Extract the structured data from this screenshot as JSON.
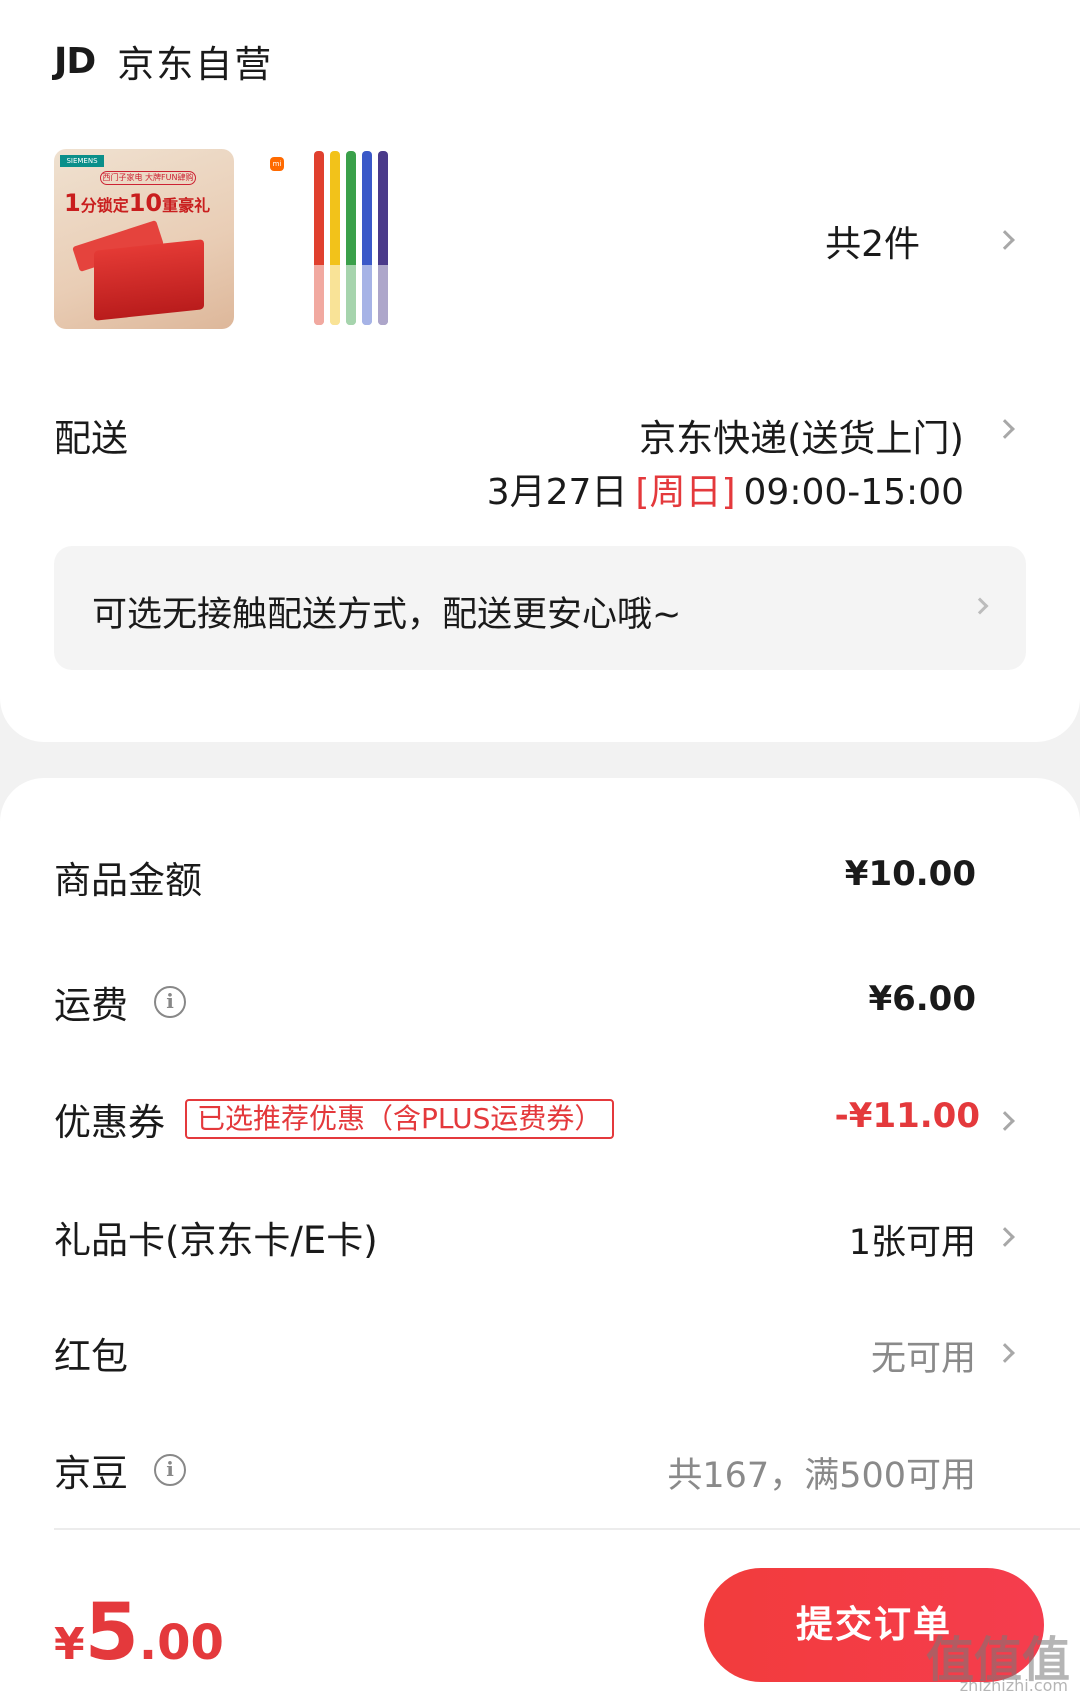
{
  "shop": {
    "logo": "JD",
    "name": "京东自营"
  },
  "products": {
    "item1": {
      "brand": "SIEMENS",
      "banner": "西门子家电 大牌FUN肆购",
      "headline_num1": "1",
      "headline_mid": "分锁定",
      "headline_num2": "10",
      "headline_tail": "重豪礼"
    },
    "item2": {
      "brand_icon": "mi"
    },
    "count_label": "共2件"
  },
  "delivery": {
    "label": "配送",
    "method": "京东快递(送货上门)",
    "date": "3月27日",
    "day": "[周日]",
    "time": "09:00-15:00",
    "contactless_tip": "可选无接触配送方式，配送更安心哦~"
  },
  "fees": {
    "goods_label": "商品金额",
    "goods_value": "¥10.00",
    "shipping_label": "运费",
    "shipping_value": "¥6.00",
    "coupon_label": "优惠券",
    "coupon_tag": "已选推荐优惠（含PLUS运费券）",
    "coupon_value": "-¥11.00",
    "giftcard_label": "礼品卡(京东卡/E卡)",
    "giftcard_value": "1张可用",
    "redpacket_label": "红包",
    "redpacket_value": "无可用",
    "beans_label": "京豆",
    "beans_value": "共167，满500可用"
  },
  "footer": {
    "total_symbol": "¥",
    "total_int": "5",
    "total_dec": ".00",
    "submit_label": "提交订单",
    "watermark": "值值值",
    "watermark_url": "zhizhizhi.com"
  },
  "colors": {
    "accent": "#e4393c",
    "background": "#f2f2f2"
  },
  "pen_colors": [
    "#e0402e",
    "#f2c21a",
    "#3aa04a",
    "#3a58c8",
    "#4a3a8a"
  ]
}
